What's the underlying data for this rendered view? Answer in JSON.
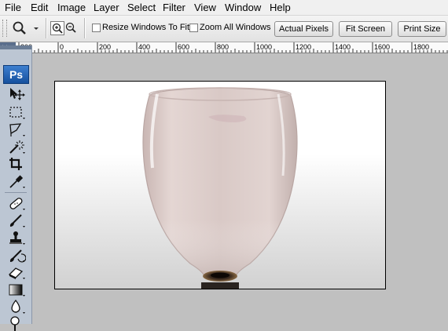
{
  "menu": {
    "items": [
      "File",
      "Edit",
      "Image",
      "Layer",
      "Select",
      "Filter",
      "View",
      "Window",
      "Help"
    ]
  },
  "options_bar": {
    "tool_icon": "zoom-icon",
    "zoom_in_icon": "zoom-in-icon",
    "zoom_out_icon": "zoom-out-icon",
    "resize_windows_label": "Resize Windows To Fit",
    "resize_windows_checked": false,
    "zoom_all_windows_label": "Zoom All Windows",
    "zoom_all_windows_checked": false,
    "actual_pixels_label": "Actual Pixels",
    "fit_screen_label": "Fit Screen",
    "print_size_label": "Print Size"
  },
  "ruler": {
    "labels": [
      "200",
      "0",
      "200",
      "400",
      "600",
      "800",
      "1000",
      "1200",
      "1400",
      "1600",
      "1800"
    ]
  },
  "toolbox": {
    "logo": "Ps",
    "tools": [
      "move-tool-icon",
      "marquee-tool-icon",
      "lasso-tool-icon",
      "magic-wand-tool-icon",
      "crop-tool-icon",
      "eyedropper-tool-icon",
      "healing-brush-tool-icon",
      "brush-tool-icon",
      "clone-stamp-tool-icon",
      "history-brush-tool-icon",
      "eraser-tool-icon",
      "gradient-tool-icon",
      "blur-tool-icon",
      "dodge-tool-icon"
    ]
  },
  "document": {
    "image": "wine-glass-photo"
  },
  "colors": {
    "chrome": "#f0f0f0",
    "toolbox": "#bcc6d3",
    "pasteboard": "#c0c0c0",
    "ps_logo": "#2a6cc0"
  }
}
